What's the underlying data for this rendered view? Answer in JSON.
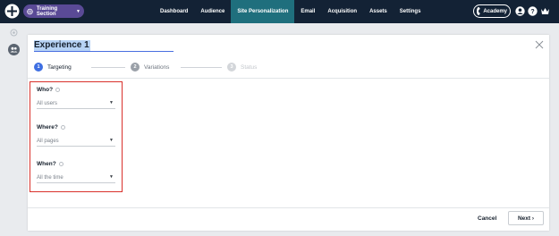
{
  "topbar": {
    "logo_icon": "brand-logo-icon",
    "section": {
      "label": "Training Section",
      "icon": "globe-icon"
    },
    "nav": [
      {
        "label": "Dashboard",
        "active": false
      },
      {
        "label": "Audience",
        "active": false
      },
      {
        "label": "Site Personalization",
        "active": true
      },
      {
        "label": "Email",
        "active": false
      },
      {
        "label": "Acquisition",
        "active": false
      },
      {
        "label": "Assets",
        "active": false
      },
      {
        "label": "Settings",
        "active": false
      }
    ],
    "academy_label": "Academy",
    "right_icons": [
      "user-icon",
      "help-icon",
      "crown-icon"
    ]
  },
  "rail": {
    "icons": [
      "settings-icon",
      "users-icon"
    ]
  },
  "panel": {
    "title": "Experience 1",
    "steps": [
      {
        "number": "1",
        "label": "Targeting",
        "state": "active"
      },
      {
        "number": "2",
        "label": "Variations",
        "state": "pending"
      },
      {
        "number": "3",
        "label": "Status",
        "state": "disabled"
      }
    ],
    "targeting": {
      "who": {
        "label": "Who?",
        "value": "All users"
      },
      "where": {
        "label": "Where?",
        "value": "All pages"
      },
      "when": {
        "label": "When?",
        "value": "All the time"
      }
    },
    "footer": {
      "cancel_label": "Cancel",
      "next_label": "Next ›"
    }
  },
  "colors": {
    "topbar_bg": "#132235",
    "nav_active": "#1f6f7d",
    "section_pill": "#5a4a96",
    "step_active": "#3e6fe2",
    "highlight_border": "#d9312b"
  }
}
